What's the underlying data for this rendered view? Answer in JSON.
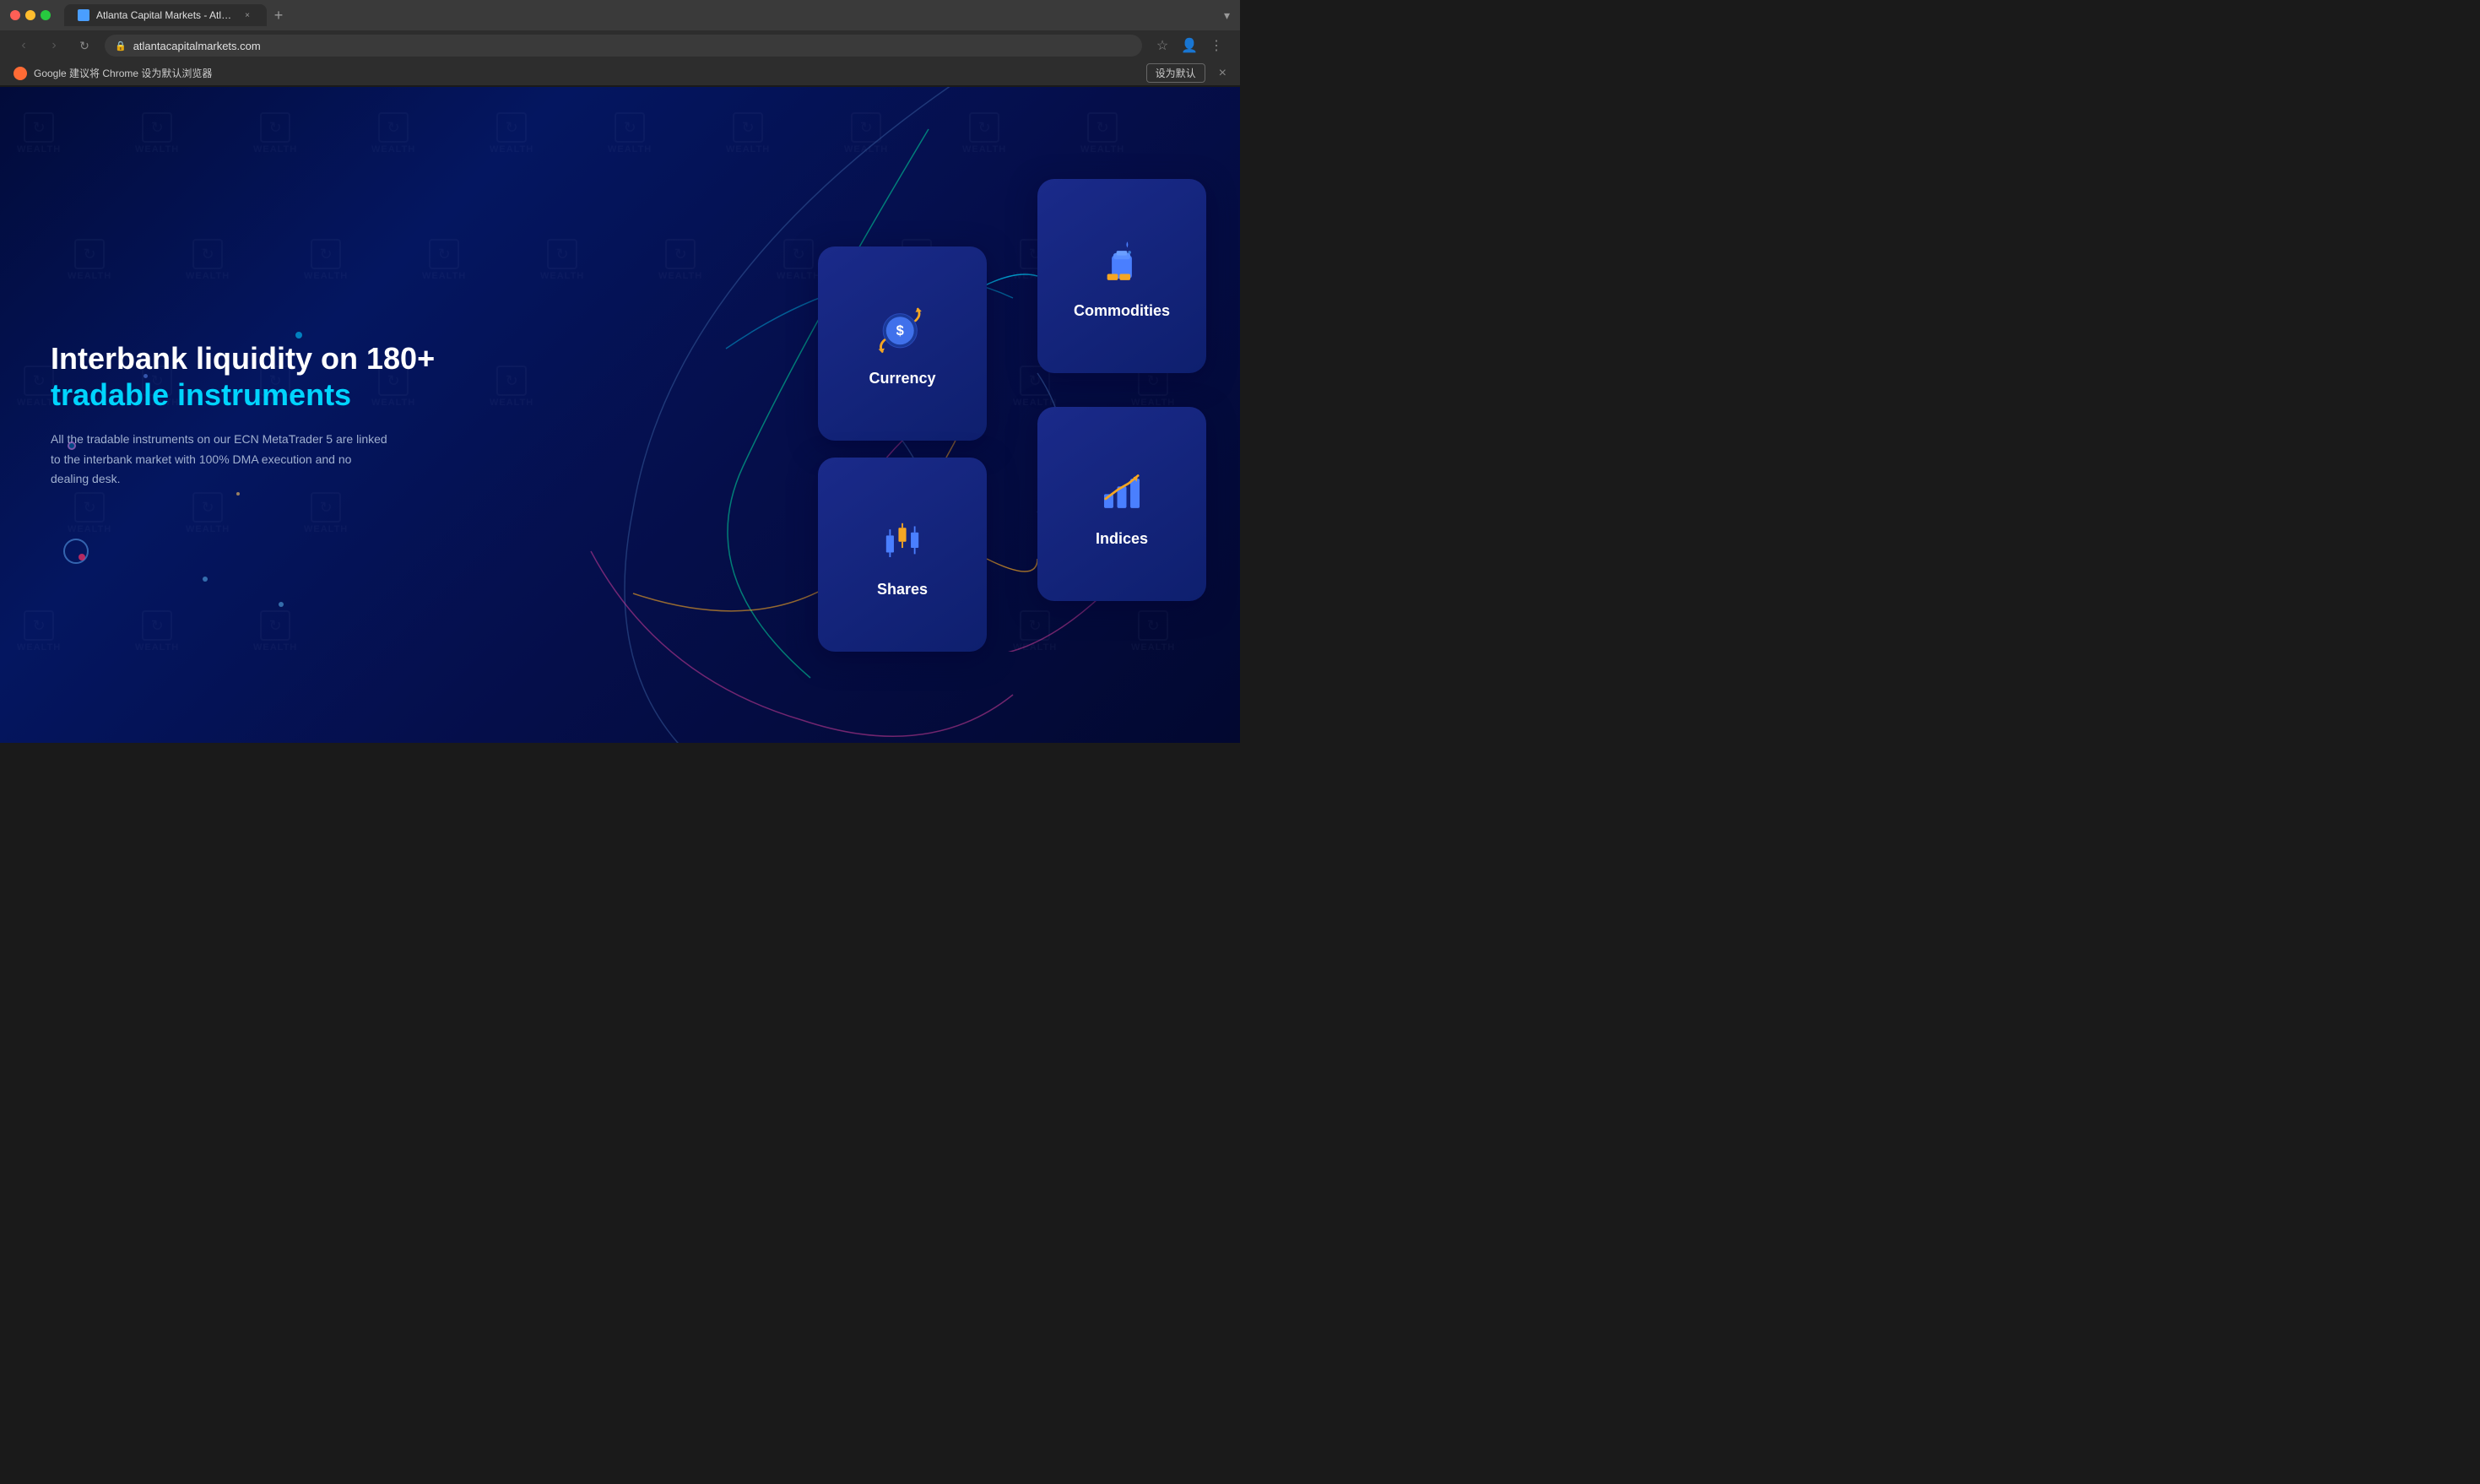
{
  "browser": {
    "title": "Atlanta Capital Markets - Atla...",
    "url": "atlantacapitalmarkets.com",
    "tab_label": "Atlanta Capital Markets - Atla...",
    "expand_icon": "▾",
    "back_icon": "‹",
    "forward_icon": "›",
    "refresh_icon": "↻",
    "lock_icon": "🔒",
    "new_tab_icon": "+",
    "bookmark_icon": "☆",
    "profile_icon": "👤",
    "menu_icon": "⋮"
  },
  "notification": {
    "text": "Google 建议将 Chrome 设为默认浏览器",
    "button": "设为默认",
    "close_icon": "×"
  },
  "page": {
    "headline_line1": "Interbank liquidity on 180+",
    "headline_line2": "tradable instruments",
    "description": "All the tradable instruments on our ECN MetaTrader 5 are linked to the interbank market with 100% DMA execution and no dealing desk.",
    "cards": [
      {
        "id": "currency",
        "label": "Currency"
      },
      {
        "id": "commodities",
        "label": "Commodities"
      },
      {
        "id": "shares",
        "label": "Shares"
      },
      {
        "id": "indices",
        "label": "Indices"
      }
    ],
    "colors": {
      "accent_blue": "#00d4ff",
      "card_bg": "#1a2a8a",
      "orange": "#f5a623",
      "icon_blue": "#4a7fff"
    }
  }
}
